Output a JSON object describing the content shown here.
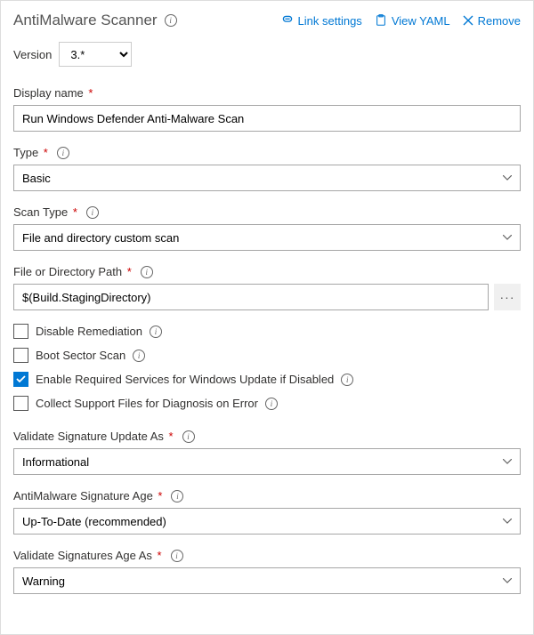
{
  "header": {
    "title": "AntiMalware Scanner",
    "actions": {
      "link": "Link settings",
      "yaml": "View YAML",
      "remove": "Remove"
    }
  },
  "version": {
    "label": "Version",
    "value": "3.*"
  },
  "displayName": {
    "label": "Display name",
    "value": "Run Windows Defender Anti-Malware Scan"
  },
  "type": {
    "label": "Type",
    "value": "Basic"
  },
  "scanType": {
    "label": "Scan Type",
    "value": "File and directory custom scan"
  },
  "path": {
    "label": "File or Directory Path",
    "value": "$(Build.StagingDirectory)"
  },
  "checkboxes": {
    "disableRemediation": {
      "label": "Disable Remediation",
      "checked": false
    },
    "bootSector": {
      "label": "Boot Sector Scan",
      "checked": false
    },
    "enableServices": {
      "label": "Enable Required Services for Windows Update if Disabled",
      "checked": true
    },
    "collectFiles": {
      "label": "Collect Support Files for Diagnosis on Error",
      "checked": false
    }
  },
  "validateSigUpdate": {
    "label": "Validate Signature Update As",
    "value": "Informational"
  },
  "sigAge": {
    "label": "AntiMalware Signature Age",
    "value": "Up-To-Date (recommended)"
  },
  "validateSigAge": {
    "label": "Validate Signatures Age As",
    "value": "Warning"
  }
}
